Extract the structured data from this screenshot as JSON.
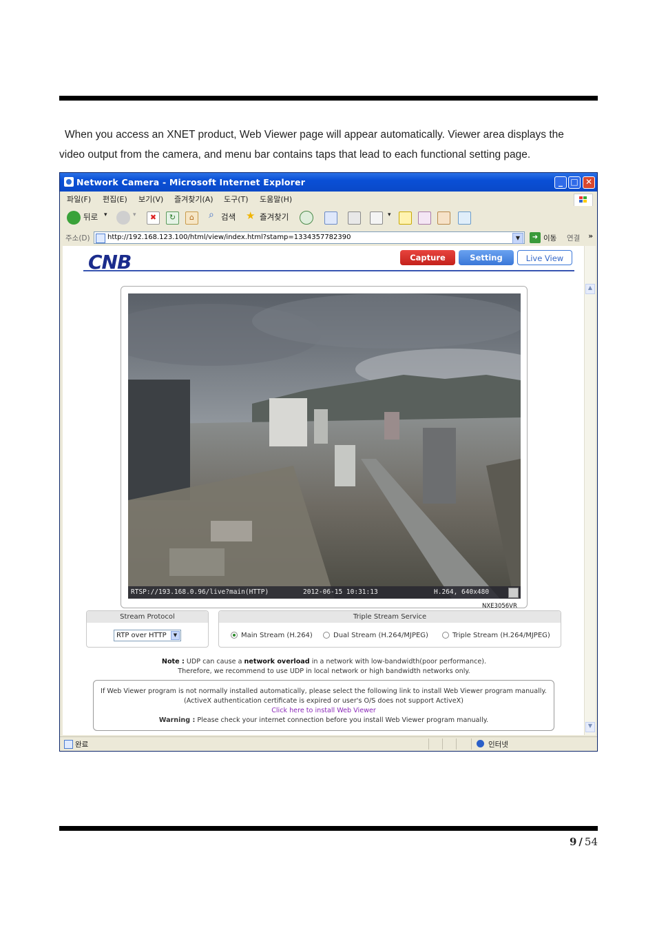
{
  "doc": {
    "intro_line1": "When you access an XNET product, Web Viewer page will appear automatically. Viewer area displays the",
    "intro_line2": "video output from the camera, and menu bar contains taps that lead to each functional setting page.",
    "page_current": "9",
    "page_sep": "/",
    "page_total": "54"
  },
  "window": {
    "title": "Network Camera - Microsoft Internet Explorer",
    "menu": [
      "파일(F)",
      "편집(E)",
      "보기(V)",
      "즐겨찾기(A)",
      "도구(T)",
      "도움말(H)"
    ],
    "toolbar": {
      "back": "뒤로",
      "search": "검색",
      "favorites": "즐겨찾기"
    },
    "address_label": "주소(D)",
    "address_url": "http://192.168.123.100/html/view/index.html?stamp=1334357782390",
    "go_label": "이동",
    "links_label": "연결",
    "more": "»",
    "status_text": "완료",
    "zone_text": "인터넷"
  },
  "viewer": {
    "logo": "CNB",
    "nav": {
      "capture": "Capture",
      "setting": "Setting",
      "live": "Live View"
    },
    "osd": {
      "stream": "RTSP://193.168.0.96/live?main(HTTP)",
      "datetime": "2012-06-15 10:31:13",
      "codec": "H.264, 640x480"
    },
    "model": "NXE3056VR",
    "stream_protocol": {
      "title": "Stream Protocol",
      "value": "RTP over HTTP"
    },
    "triple_stream": {
      "title": "Triple Stream Service",
      "options": [
        "Main Stream (H.264)",
        "Dual Stream (H.264/MJPEG)",
        "Triple Stream (H.264/MJPEG)"
      ],
      "selected_index": 0
    },
    "note": {
      "label": "Note :",
      "part1": " UDP can cause a ",
      "bold": "network overload",
      "part2": " in a network with low-bandwidth(poor performance).",
      "line2": "Therefore, we recommend to use UDP in local network or high bandwidth networks only."
    },
    "info": {
      "line1": "If Web Viewer program is not normally installed automatically, please select the following link to install Web Viewer program manually.",
      "line2": "(ActiveX authentication certificate is expired or user's O/S does not support ActiveX)",
      "link": "Click here to install Web Viewer",
      "warning_label": "Warning :",
      "warning_text": " Please check your internet connection before you install Web Viewer program manually."
    }
  },
  "colors": {
    "capture": "#d42a24",
    "setting": "#4a86e0",
    "brand": "#1b2c8c",
    "link": "#8a2ab8"
  }
}
